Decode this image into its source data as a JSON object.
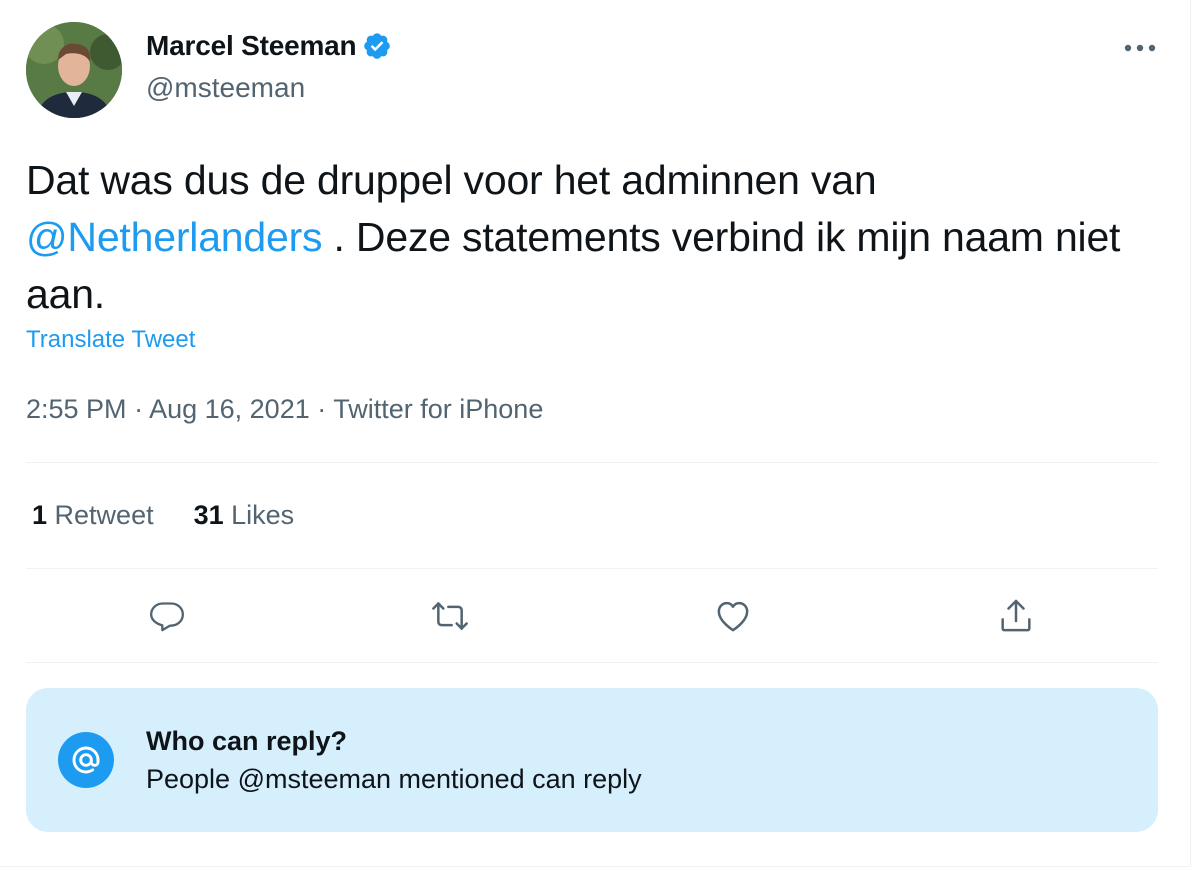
{
  "author": {
    "name": "Marcel Steeman",
    "handle": "@msteeman",
    "verified": true
  },
  "tweet": {
    "text_before": "Dat was dus de druppel voor het adminnen van",
    "mention": "@Netherlanders",
    "text_after": " . Deze statements verbind ik mijn naam niet aan.",
    "translate_label": "Translate Tweet"
  },
  "meta": {
    "time": "2:55 PM",
    "sep1": " · ",
    "date": "Aug 16, 2021",
    "sep2": " · ",
    "source": "Twitter for iPhone"
  },
  "stats": {
    "retweets_count": "1",
    "retweets_label": " Retweet",
    "likes_count": "31",
    "likes_label": " Likes"
  },
  "actions": [
    "reply-icon",
    "retweet-icon",
    "like-icon",
    "share-icon"
  ],
  "reply_settings": {
    "title": "Who can reply?",
    "subtitle": "People @msteeman mentioned can reply"
  },
  "colors": {
    "accent": "#1d9bf0",
    "secondary_text": "#536471",
    "reply_box_bg": "#d6effd"
  }
}
